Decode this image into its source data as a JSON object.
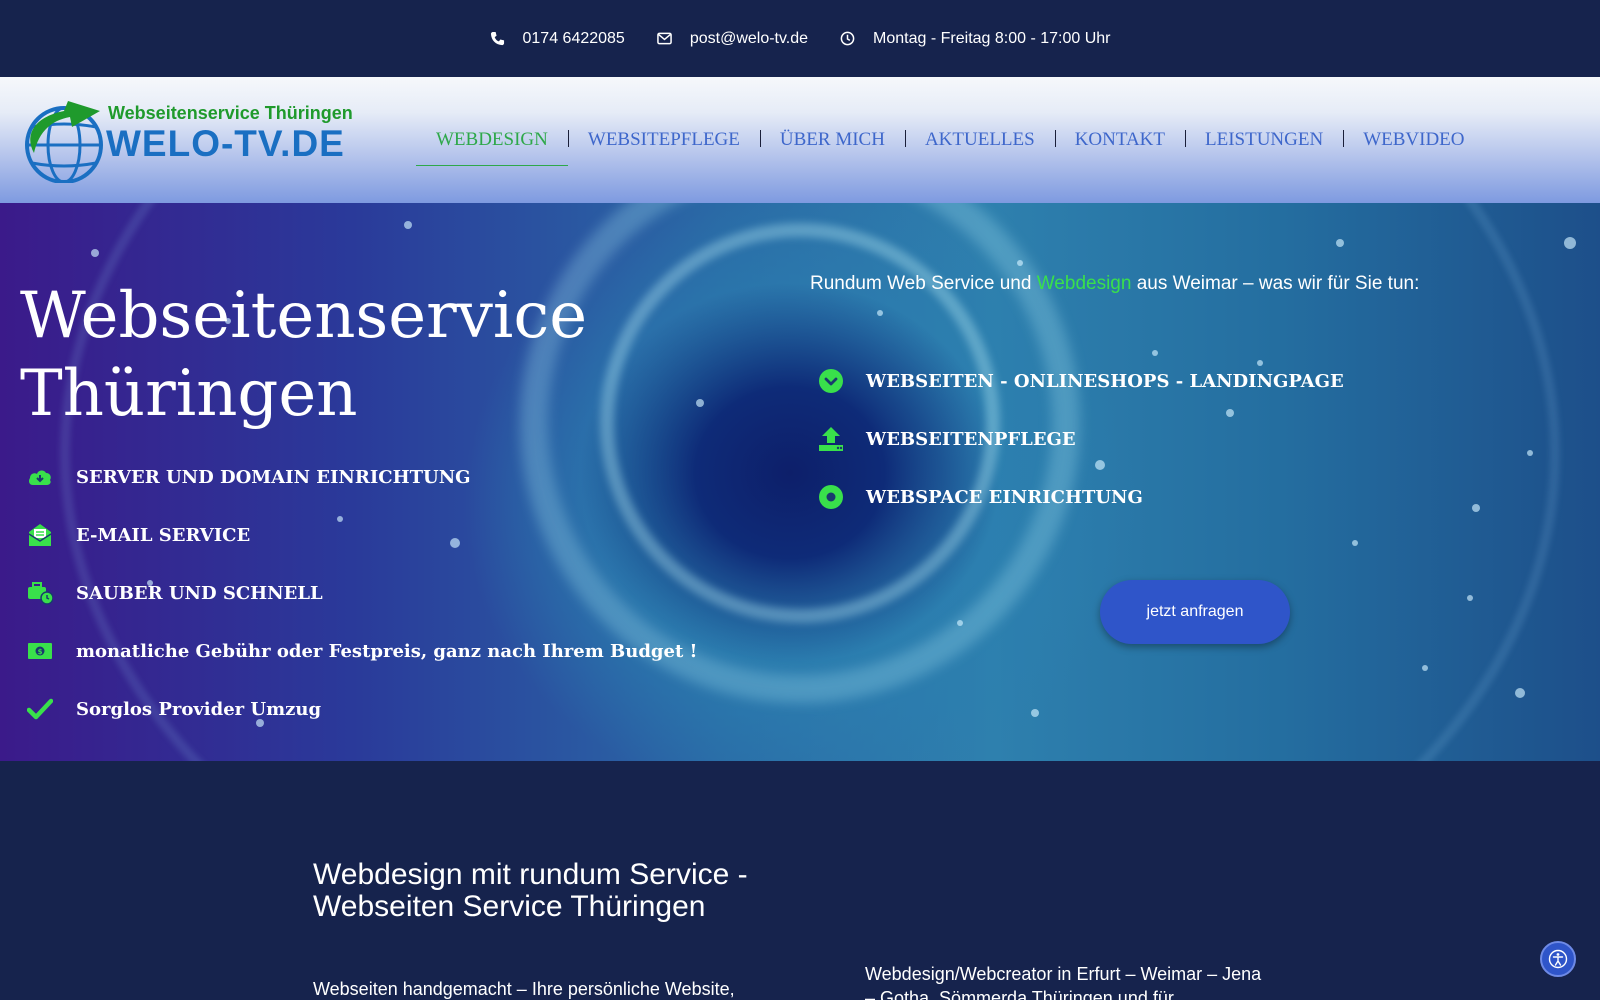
{
  "topbar": {
    "phone": "0174 6422085",
    "email": "post@welo-tv.de",
    "hours": "Montag - Freitag 8:00 - 17:00 Uhr"
  },
  "logo": {
    "tagline": "Webseitenservice Thüringen",
    "name": "WELO-TV.DE"
  },
  "nav": {
    "items": [
      {
        "label": "WEBDESIGN",
        "active": true
      },
      {
        "label": "WEBSITEPFLEGE"
      },
      {
        "label": "ÜBER MICH"
      },
      {
        "label": "AKTUELLES"
      },
      {
        "label": "KONTAKT"
      },
      {
        "label": "LEISTUNGEN"
      },
      {
        "label": "WEBVIDEO"
      }
    ]
  },
  "hero": {
    "title_line1": "Webseitenservice",
    "title_line2": "Thüringen",
    "features": [
      {
        "icon": "cloud-download-icon",
        "label": "SERVER UND DOMAIN EINRICHTUNG"
      },
      {
        "icon": "envelope-open-icon",
        "label": "E-MAIL SERVICE"
      },
      {
        "icon": "briefcase-clock-icon",
        "label": "SAUBER UND SCHNELL"
      },
      {
        "icon": "money-bill-icon",
        "label": "monatliche Gebühr oder Festpreis, ganz nach Ihrem Budget !"
      },
      {
        "icon": "checkmark-icon",
        "label": "Sorglos Provider Umzug"
      }
    ],
    "intro_before": "Rundum Web Service und ",
    "intro_highlight": "Webdesign",
    "intro_after": " aus Weimar – was wir für Sie tun:",
    "services": [
      {
        "icon": "chevron-circle-icon",
        "label": "WEBSEITEN - ONLINESHOPS - LANDINGPAGE"
      },
      {
        "icon": "upload-icon",
        "label": "WEBSEITENPFLEGE"
      },
      {
        "icon": "dot-circle-icon",
        "label": "WEBSPACE EINRICHTUNG"
      }
    ],
    "cta_label": "jetzt anfragen"
  },
  "section": {
    "title": "Webdesign mit rundum Service - Webseiten Service Thüringen",
    "para1": "Webseiten handgemacht – Ihre persönliche Website,",
    "para2": "Webdesign/Webcreator in Erfurt – Weimar – Jena – Gotha, Sömmerda Thüringen und für"
  },
  "colors": {
    "accent_green": "#39e04b",
    "nav_blue": "#3e67cb",
    "dark_bg": "#16234d",
    "button_blue": "#2f55c9"
  }
}
